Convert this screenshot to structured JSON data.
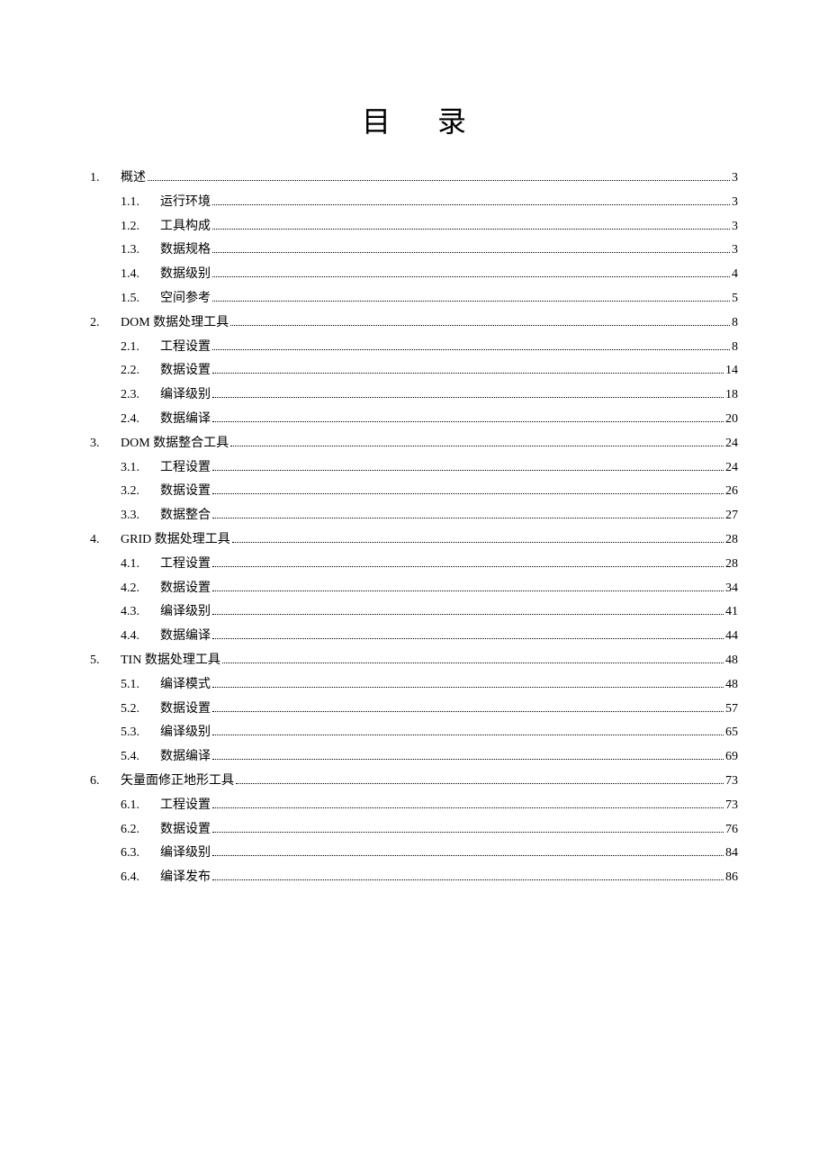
{
  "title": "目 录",
  "toc": [
    {
      "num": "1.",
      "label": "概述",
      "page": "3",
      "children": [
        {
          "num": "1.1.",
          "label": "运行环境",
          "page": "3"
        },
        {
          "num": "1.2.",
          "label": "工具构成",
          "page": "3"
        },
        {
          "num": "1.3.",
          "label": "数据规格",
          "page": "3"
        },
        {
          "num": "1.4.",
          "label": "数据级别",
          "page": "4"
        },
        {
          "num": "1.5.",
          "label": "空间参考",
          "page": "5"
        }
      ]
    },
    {
      "num": "2.",
      "label": "DOM 数据处理工具",
      "page": "8",
      "children": [
        {
          "num": "2.1.",
          "label": "工程设置",
          "page": "8"
        },
        {
          "num": "2.2.",
          "label": "数据设置",
          "page": "14"
        },
        {
          "num": "2.3.",
          "label": "编译级别",
          "page": "18"
        },
        {
          "num": "2.4.",
          "label": "数据编译",
          "page": "20"
        }
      ]
    },
    {
      "num": "3.",
      "label": "DOM 数据整合工具",
      "page": "24",
      "children": [
        {
          "num": "3.1.",
          "label": "工程设置",
          "page": "24"
        },
        {
          "num": "3.2.",
          "label": "数据设置",
          "page": "26"
        },
        {
          "num": "3.3.",
          "label": "数据整合",
          "page": "27"
        }
      ]
    },
    {
      "num": "4.",
      "label": "GRID 数据处理工具",
      "page": "28",
      "children": [
        {
          "num": "4.1.",
          "label": "工程设置",
          "page": "28"
        },
        {
          "num": "4.2.",
          "label": "数据设置",
          "page": "34"
        },
        {
          "num": "4.3.",
          "label": "编译级别",
          "page": "41"
        },
        {
          "num": "4.4.",
          "label": "数据编译",
          "page": "44"
        }
      ]
    },
    {
      "num": "5.",
      "label": "TIN 数据处理工具",
      "page": "48",
      "children": [
        {
          "num": "5.1.",
          "label": "编译模式",
          "page": "48"
        },
        {
          "num": "5.2.",
          "label": "数据设置",
          "page": "57"
        },
        {
          "num": "5.3.",
          "label": "编译级别",
          "page": "65"
        },
        {
          "num": "5.4.",
          "label": "数据编译",
          "page": "69"
        }
      ]
    },
    {
      "num": "6.",
      "label": "矢量面修正地形工具",
      "page": "73",
      "children": [
        {
          "num": "6.1.",
          "label": "工程设置",
          "page": "73"
        },
        {
          "num": "6.2.",
          "label": "数据设置",
          "page": "76"
        },
        {
          "num": "6.3.",
          "label": "编译级别",
          "page": "84"
        },
        {
          "num": "6.4.",
          "label": "编译发布",
          "page": "86"
        }
      ]
    }
  ]
}
